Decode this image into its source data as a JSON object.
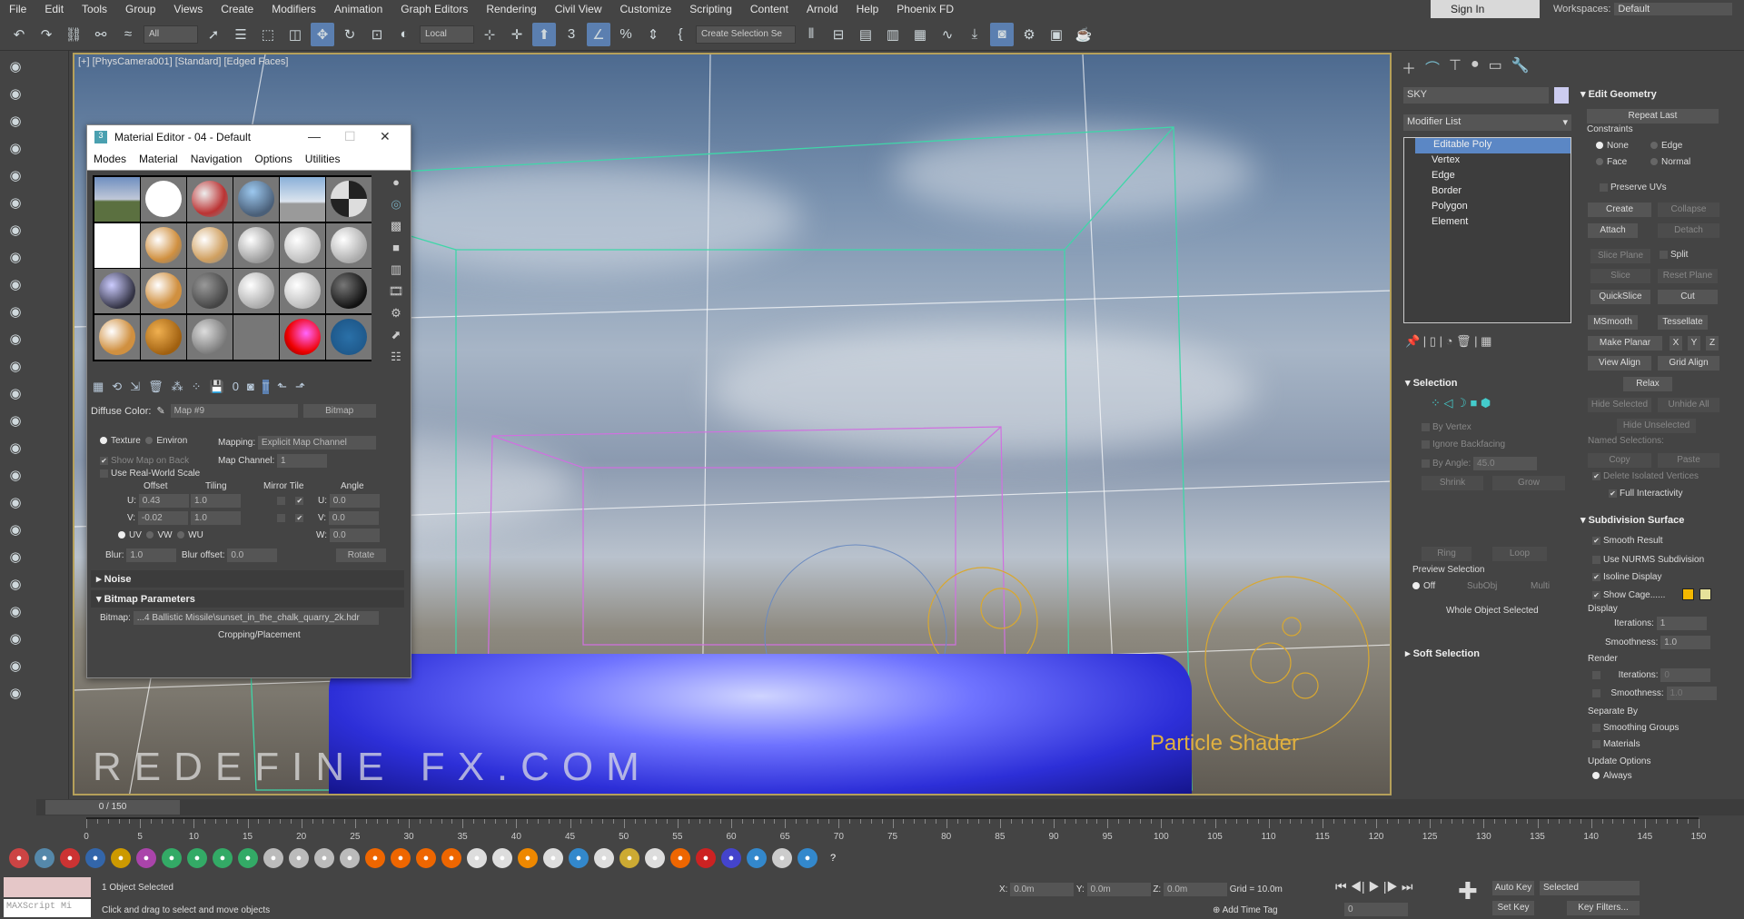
{
  "menu": [
    "File",
    "Edit",
    "Tools",
    "Group",
    "Views",
    "Create",
    "Modifiers",
    "Animation",
    "Graph Editors",
    "Rendering",
    "Civil View",
    "Customize",
    "Scripting",
    "Content",
    "Arnold",
    "Help",
    "Phoenix FD"
  ],
  "signin": "Sign In",
  "workspaces": {
    "label": "Workspaces:",
    "value": "Default"
  },
  "toolbar": {
    "filter": "All",
    "coord": "Local",
    "selection_set": "Create Selection Se"
  },
  "viewport": {
    "label": "[+] [PhysCamera001] [Standard] [Edged Faces]",
    "overlay_text": "Particle Shader",
    "watermark": "REDEFINE FX.COM"
  },
  "material_editor": {
    "title": "Material Editor - 04 - Default",
    "menu": [
      "Modes",
      "Material",
      "Navigation",
      "Options",
      "Utilities"
    ],
    "diffuse_label": "Diffuse Color:",
    "map_name": "Map #9",
    "map_type": "Bitmap",
    "texture": "Texture",
    "environ": "Environ",
    "mapping_label": "Mapping:",
    "mapping": "Explicit Map Channel",
    "show_map_on_back": "Show Map on Back",
    "map_channel_label": "Map Channel:",
    "map_channel": "1",
    "use_real_world": "Use Real-World Scale",
    "offset": "Offset",
    "tiling": "Tiling",
    "mirror_tile": "Mirror Tile",
    "angle": "Angle",
    "u": "U:",
    "v": "V:",
    "w": "W:",
    "offset_u": "0.43",
    "offset_v": "-0.02",
    "tiling_u": "1.0",
    "tiling_v": "1.0",
    "angle_u": "0.0",
    "angle_v": "0.0",
    "angle_w": "0.0",
    "uv": "UV",
    "vw": "VW",
    "wu": "WU",
    "blur_label": "Blur:",
    "blur": "1.0",
    "blur_offset_label": "Blur offset:",
    "blur_offset": "0.0",
    "rotate": "Rotate",
    "noise": "Noise",
    "bitmap_params": "Bitmap Parameters",
    "bitmap_label": "Bitmap:",
    "bitmap_path": "...4 Ballistic Missile\\sunset_in_the_chalk_quarry_2k.hdr",
    "cropping": "Cropping/Placement"
  },
  "command_panel": {
    "object_name": "SKY",
    "object_color": "#ccccf0",
    "modifier_list": "Modifier List",
    "stack": [
      "Editable Poly",
      "Vertex",
      "Edge",
      "Border",
      "Polygon",
      "Element"
    ],
    "selection": {
      "title": "Selection",
      "by_vertex": "By Vertex",
      "ignore_backfacing": "Ignore Backfacing",
      "by_angle": "By Angle:",
      "angle": "45.0",
      "shrink": "Shrink",
      "grow": "Grow",
      "ring": "Ring",
      "loop": "Loop",
      "preview": "Preview Selection",
      "off": "Off",
      "subobj": "SubObj",
      "multi": "Multi",
      "status": "Whole Object Selected"
    },
    "soft_selection": "Soft Selection",
    "edit_geometry": {
      "title": "Edit Geometry",
      "repeat_last": "Repeat Last",
      "constraints": "Constraints",
      "none": "None",
      "edge": "Edge",
      "face": "Face",
      "normal": "Normal",
      "preserve_uvs": "Preserve UVs",
      "create": "Create",
      "collapse": "Collapse",
      "attach": "Attach",
      "detach": "Detach",
      "slice_plane": "Slice Plane",
      "split": "Split",
      "slice": "Slice",
      "reset_plane": "Reset Plane",
      "quickslice": "QuickSlice",
      "cut": "Cut",
      "msmooth": "MSmooth",
      "tessellate": "Tessellate",
      "make_planar": "Make Planar",
      "x": "X",
      "y": "Y",
      "z": "Z",
      "view_align": "View Align",
      "grid_align": "Grid Align",
      "relax": "Relax",
      "hide_selected": "Hide Selected",
      "unhide_all": "Unhide All",
      "hide_unselected": "Hide Unselected",
      "named_selections": "Named Selections:",
      "copy": "Copy",
      "paste": "Paste",
      "delete_isolated": "Delete Isolated Vertices",
      "full_interactivity": "Full Interactivity"
    },
    "subdivision": {
      "title": "Subdivision Surface",
      "smooth_result": "Smooth Result",
      "use_nurms": "Use NURMS Subdivision",
      "isoline": "Isoline Display",
      "show_cage": "Show Cage......",
      "cage_color1": "#f5b800",
      "cage_color2": "#e6e29a",
      "display": "Display",
      "iterations": "Iterations:",
      "smoothness": "Smoothness:",
      "disp_iter": "1",
      "disp_smooth": "1.0",
      "render": "Render",
      "rend_iter": "0",
      "rend_smooth": "1.0",
      "separate_by": "Separate By",
      "smoothing_groups": "Smoothing Groups",
      "materials": "Materials",
      "update_options": "Update Options",
      "always": "Always"
    }
  },
  "timeline": {
    "frame": "0 / 150",
    "ticks": [
      "0",
      "5",
      "10",
      "15",
      "20",
      "25",
      "30",
      "35",
      "40",
      "45",
      "50",
      "55",
      "60",
      "65",
      "70",
      "75",
      "80",
      "85",
      "90",
      "95",
      "100",
      "105",
      "110",
      "115",
      "120",
      "125",
      "130",
      "135",
      "140",
      "145",
      "150"
    ]
  },
  "status": {
    "maxscript": "MAXScript Mi",
    "selected": "1 Object Selected",
    "hint": "Click and drag to select and move objects",
    "x_label": "X:",
    "x": "0.0m",
    "y_label": "Y:",
    "y": "0.0m",
    "z_label": "Z:",
    "z": "0.0m",
    "grid": "Grid = 10.0m",
    "add_time_tag": "Add Time Tag",
    "auto_key": "Auto Key",
    "key_mode": "Selected",
    "set_key": "Set Key",
    "key_filters": "Key Filters...",
    "current_frame": "0"
  }
}
